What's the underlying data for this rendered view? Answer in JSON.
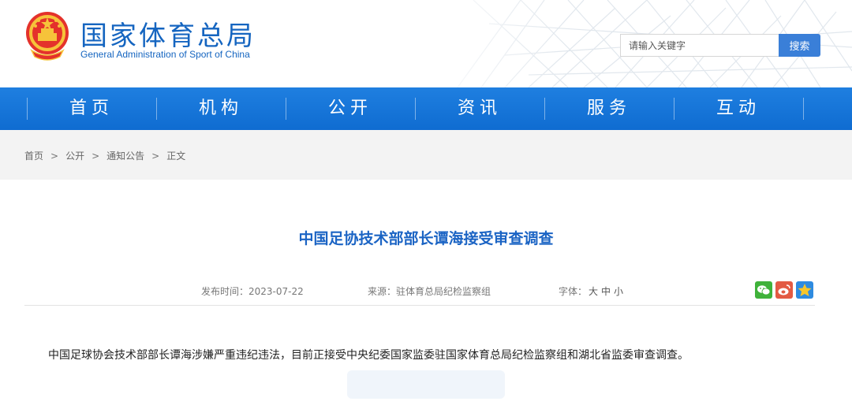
{
  "header": {
    "title_cn": "国家体育总局",
    "title_en": "General Administration of Sport of China",
    "search_placeholder": "请输入关键字",
    "search_button": "搜索"
  },
  "nav": {
    "items": [
      {
        "label": "首页"
      },
      {
        "label": "机构"
      },
      {
        "label": "公开"
      },
      {
        "label": "资讯"
      },
      {
        "label": "服务"
      },
      {
        "label": "互动"
      }
    ]
  },
  "breadcrumb": {
    "items": [
      "首页",
      "公开",
      "通知公告",
      "正文"
    ],
    "separator": ">"
  },
  "article": {
    "title": "中国足协技术部部长谭海接受审查调查",
    "publish_label": "发布时间：",
    "publish_date": "2023-07-22",
    "source_label": "来源：",
    "source": "驻体育总局纪检监察组",
    "font_label": "字体：",
    "font_large": "大",
    "font_medium": "中",
    "font_small": "小",
    "body": "中国足球协会技术部部长谭海涉嫌严重违纪违法，目前正接受中央纪委国家监委驻国家体育总局纪检监察组和湖北省监委审查调查。"
  },
  "share": {
    "icons": [
      "wechat-icon",
      "weibo-icon",
      "qzone-icon"
    ]
  },
  "colors": {
    "brand_blue": "#1565c0",
    "nav_blue": "#1677dc",
    "title_blue": "#1b64c4",
    "search_button": "#3a7fd8"
  }
}
